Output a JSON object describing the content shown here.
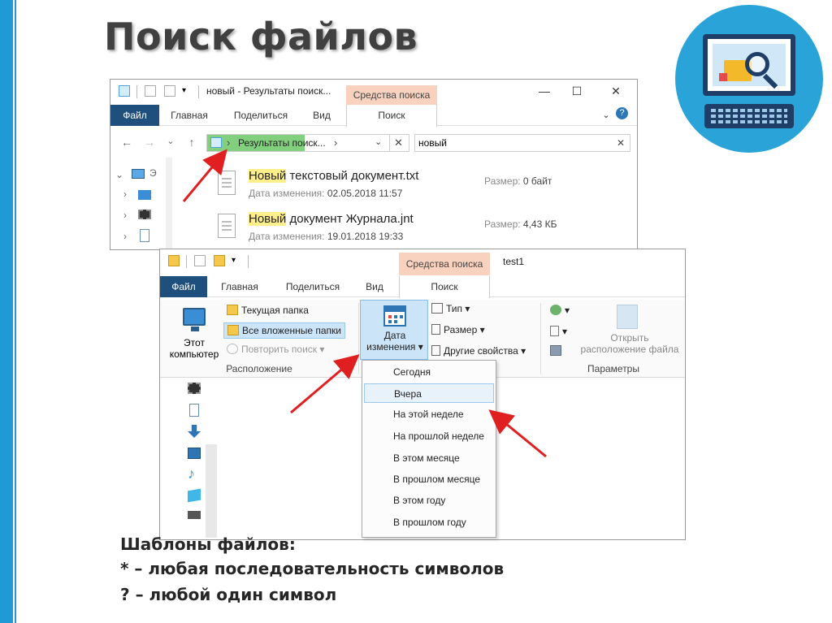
{
  "slide": {
    "title": "Поиск файлов",
    "bottom_lines": [
      "Шаблоны файлов:",
      "* – любая последовательность символов",
      "? – любой один символ"
    ]
  },
  "colors": {
    "accent_blue": "#1f9ad6",
    "file_tab": "#1f4f7c",
    "context_tab": "#f8d2bf",
    "highlight": "#ffef8a",
    "address_green": "#82d07e",
    "arrow_red": "#e02020"
  },
  "window1": {
    "title": "новый - Результаты поиск...",
    "context_header": "Средства поиска",
    "tabs": [
      "Файл",
      "Главная",
      "Поделиться",
      "Вид",
      "Поиск"
    ],
    "controls": {
      "minimize": "—",
      "maximize": "☐",
      "close": "✕",
      "expand": "⌄",
      "help": "?"
    },
    "nav": {
      "back": "←",
      "forward": "→",
      "recent": "⌄",
      "up": "↑"
    },
    "address": "Результаты поиск...",
    "address_sep": "›",
    "address_dropdown": "⌄",
    "address_clear": "✕",
    "search_value": "новый",
    "search_clear": "✕",
    "tree_first_label": "Э",
    "tree_chevron": "›",
    "tree_expanded_chevron": "⌄",
    "files": [
      {
        "name_highlight": "Новый",
        "name_rest": " текстовый документ.txt",
        "modified_label": "Дата изменения:",
        "modified": "02.05.2018 11:57",
        "size_label": "Размер:",
        "size": "0 байт"
      },
      {
        "name_highlight": "Новый",
        "name_rest": " документ Журнала.jnt",
        "modified_label": "Дата изменения:",
        "modified": "19.01.2018 19:33",
        "size_label": "Размер:",
        "size": "4,43 КБ"
      }
    ]
  },
  "window2": {
    "title": "test1",
    "context_header": "Средства поиска",
    "tabs": [
      "Файл",
      "Главная",
      "Поделиться",
      "Вид",
      "Поиск"
    ],
    "location_group": {
      "label": "Расположение",
      "this_pc": [
        "Этот",
        "компьютер"
      ],
      "current_folder": "Текущая папка",
      "all_subfolders": "Все вложенные папки",
      "repeat_search": "Повторить поиск"
    },
    "refine_group": {
      "date_modified": [
        "Дата",
        "изменения"
      ],
      "type": "Тип",
      "size": "Размер",
      "other_props": "Другие свойства"
    },
    "options_group": {
      "label": "Параметры",
      "open_location": [
        "Открыть",
        "расположение файла"
      ]
    },
    "dropdown_caret": "▾",
    "date_menu": [
      "Сегодня",
      "Вчера",
      "На этой неделе",
      "На прошлой неделе",
      "В этом месяце",
      "В прошлом месяце",
      "В этом году",
      "В прошлом году"
    ],
    "date_menu_selected": "Вчера"
  }
}
